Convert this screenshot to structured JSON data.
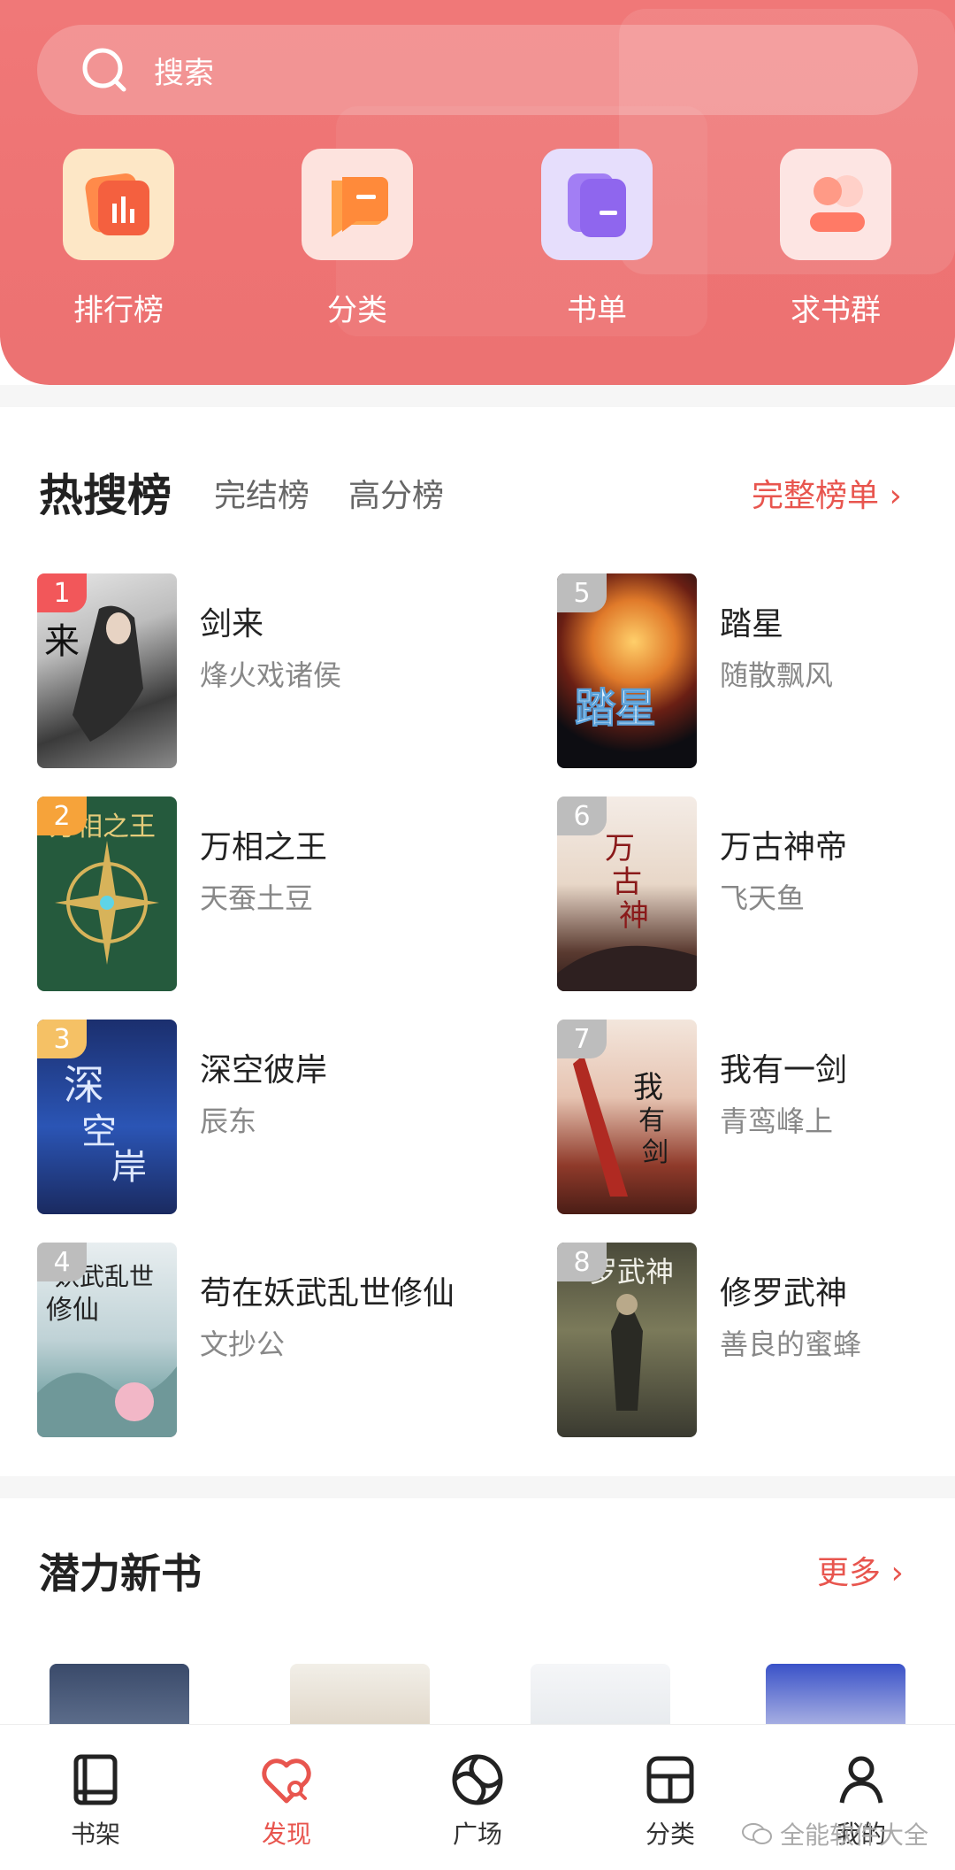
{
  "search": {
    "placeholder": "搜索"
  },
  "quick_entries": [
    {
      "label": "排行榜",
      "icon": "rank-icon"
    },
    {
      "label": "分类",
      "icon": "category-icon"
    },
    {
      "label": "书单",
      "icon": "booklist-icon"
    },
    {
      "label": "求书群",
      "icon": "group-icon"
    }
  ],
  "hot": {
    "title": "热搜榜",
    "tabs": [
      "完结榜",
      "高分榜"
    ],
    "more": "完整榜单 ›"
  },
  "books": [
    {
      "rank": "1",
      "title": "剑来",
      "author": "烽火戏诸侯"
    },
    {
      "rank": "2",
      "title": "万相之王",
      "author": "天蚕土豆"
    },
    {
      "rank": "3",
      "title": "深空彼岸",
      "author": "辰东"
    },
    {
      "rank": "4",
      "title": "苟在妖武乱世修仙",
      "author": "文抄公"
    },
    {
      "rank": "5",
      "title": "踏星",
      "author": "随散飘风"
    },
    {
      "rank": "6",
      "title": "万古神帝",
      "author": "飞天鱼"
    },
    {
      "rank": "7",
      "title": "我有一剑",
      "author": "青鸾峰上"
    },
    {
      "rank": "8",
      "title": "修罗武神",
      "author": "善良的蜜蜂"
    }
  ],
  "new_books": {
    "title": "潜力新书",
    "more": "更多 ›"
  },
  "tabbar": [
    {
      "label": "书架",
      "icon": "bookshelf-icon"
    },
    {
      "label": "发现",
      "icon": "discover-icon"
    },
    {
      "label": "广场",
      "icon": "plaza-icon"
    },
    {
      "label": "分类",
      "icon": "category-tab-icon"
    },
    {
      "label": "我的",
      "icon": "profile-icon"
    }
  ],
  "watermark": "全能软件大全",
  "colors": {
    "accent": "#e8554e",
    "header": "#ef7474"
  }
}
